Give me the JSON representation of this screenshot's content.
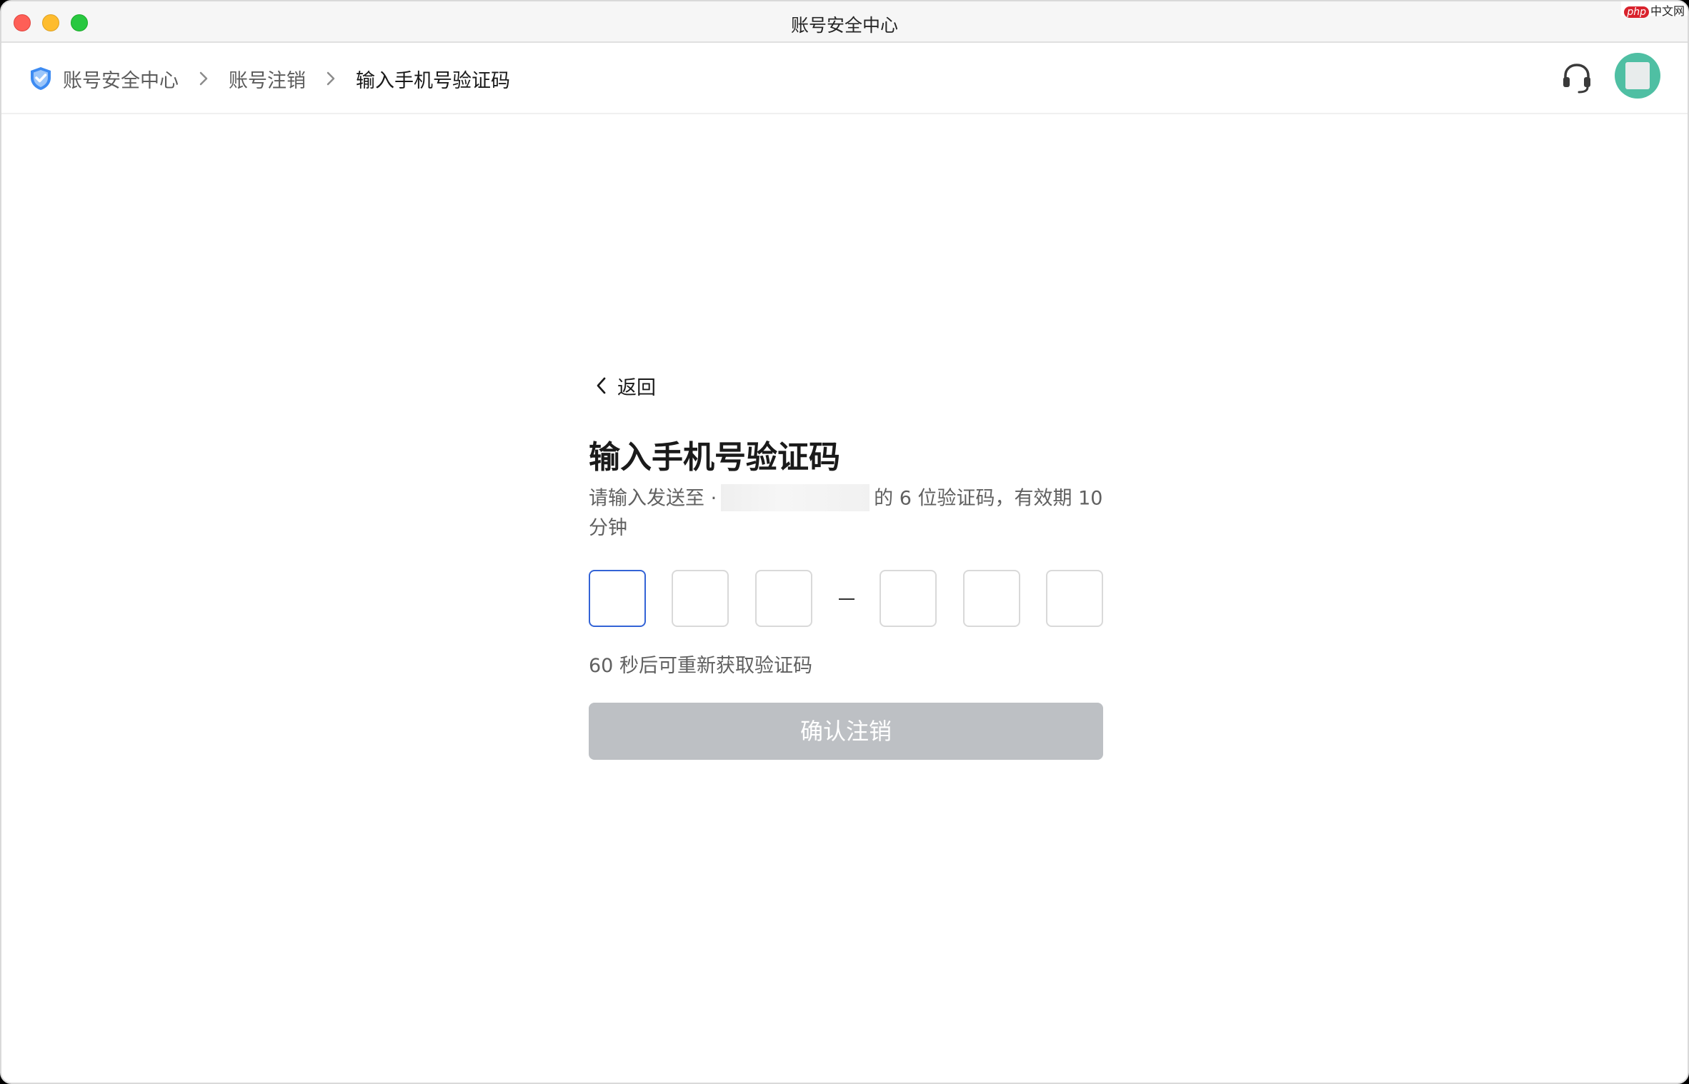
{
  "window": {
    "title": "账号安全中心",
    "watermark": "中文网",
    "watermark_badge": "php"
  },
  "breadcrumb": {
    "items": [
      {
        "label": "账号安全中心"
      },
      {
        "label": "账号注销"
      },
      {
        "label": "输入手机号验证码"
      }
    ],
    "icons": {
      "root": "shield-icon",
      "separator": "chevron-right-icon"
    }
  },
  "header": {
    "support_icon": "headset-icon",
    "avatar_color": "#4fbfa3"
  },
  "page": {
    "back_label": "返回",
    "title": "输入手机号验证码",
    "desc_prefix": "请输入发送至 ·",
    "desc_suffix": "的 6 位验证码，有效期 10 分钟",
    "code": [
      "",
      "",
      "",
      "",
      "",
      ""
    ],
    "resend_text": "60 秒后可重新获取验证码",
    "confirm_label": "确认注销"
  },
  "colors": {
    "accent": "#3363d6",
    "button_disabled": "#bdc0c4",
    "shield": "#3d8bf2"
  }
}
